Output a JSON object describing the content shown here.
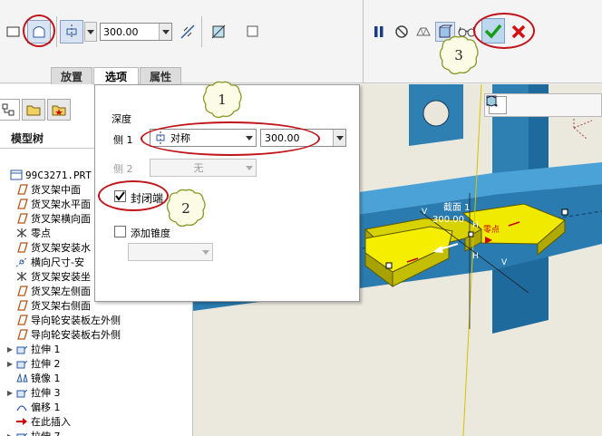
{
  "toolbar": {
    "depth_value": "300.00",
    "icons": [
      "surface-icon",
      "closed-surface-icon",
      "symmetric-depth-icon",
      "flip-direction-icon",
      "thin-feature-icon",
      "pause-icon",
      "no-preview-icon",
      "preview-icon",
      "verify-icon",
      "glasses-icon",
      "confirm-check-icon",
      "cancel-x-icon"
    ]
  },
  "tabs": [
    {
      "label": "放置",
      "active": false
    },
    {
      "label": "选项",
      "active": true
    },
    {
      "label": "属性",
      "active": false
    }
  ],
  "panel": {
    "depth_label": "深度",
    "side1_label": "侧 1",
    "side1_type": "对称",
    "side1_value": "300.00",
    "side2_label": "侧 2",
    "side2_type": "无",
    "capped_label": "封闭端",
    "capped_checked": true,
    "draft_label": "添加锥度",
    "draft_checked": false
  },
  "tree": {
    "title": "模型树",
    "items": [
      {
        "label": "99C3271.PRT",
        "icon": "part-icon",
        "expand": ""
      },
      {
        "label": "货叉架中面",
        "icon": "datum-plane-icon",
        "expand": ""
      },
      {
        "label": "货叉架水平面",
        "icon": "datum-plane-icon",
        "expand": ""
      },
      {
        "label": "货叉架横向面",
        "icon": "datum-plane-icon",
        "expand": ""
      },
      {
        "label": "零点",
        "icon": "coordinate-system-icon",
        "expand": ""
      },
      {
        "label": "货叉架安装水",
        "icon": "datum-plane-icon",
        "expand": ""
      },
      {
        "label": "横向尺寸-安",
        "icon": "datum-axis-icon",
        "expand": ""
      },
      {
        "label": "货叉架安装坐",
        "icon": "coordinate-system-icon",
        "expand": ""
      },
      {
        "label": "货叉架左侧面",
        "icon": "datum-plane-icon",
        "expand": ""
      },
      {
        "label": "货叉架右侧面",
        "icon": "datum-plane-icon",
        "expand": ""
      },
      {
        "label": "导向轮安装板左外侧",
        "icon": "datum-plane-icon",
        "expand": ""
      },
      {
        "label": "导向轮安装板右外侧",
        "icon": "datum-plane-icon",
        "expand": ""
      },
      {
        "label": "拉伸 1",
        "icon": "extrude-icon",
        "expand": "▶"
      },
      {
        "label": "拉伸 2",
        "icon": "extrude-icon",
        "expand": "▶"
      },
      {
        "label": "镜像 1",
        "icon": "mirror-icon",
        "expand": ""
      },
      {
        "label": "拉伸 3",
        "icon": "extrude-icon",
        "expand": "▶"
      },
      {
        "label": "偏移 1",
        "icon": "offset-icon",
        "expand": ""
      },
      {
        "label": "在此插入",
        "icon": "insert-here-arrow-icon",
        "expand": ""
      },
      {
        "label": "拉伸 7",
        "icon": "extrude-icon",
        "expand": "▶"
      }
    ]
  },
  "graphics": {
    "section_label": "截面 1",
    "dimension_value": "300.00",
    "label_v": "V",
    "label_h": "H",
    "label_zero": "零点"
  },
  "annotations": [
    "1",
    "2",
    "3"
  ],
  "colors": {
    "accent_red": "#c0141a",
    "part_blue": "#2e7fb2",
    "preview_yellow": "#e8e000",
    "confirm_green": "#1a9c1a",
    "cancel_red": "#d41010"
  }
}
